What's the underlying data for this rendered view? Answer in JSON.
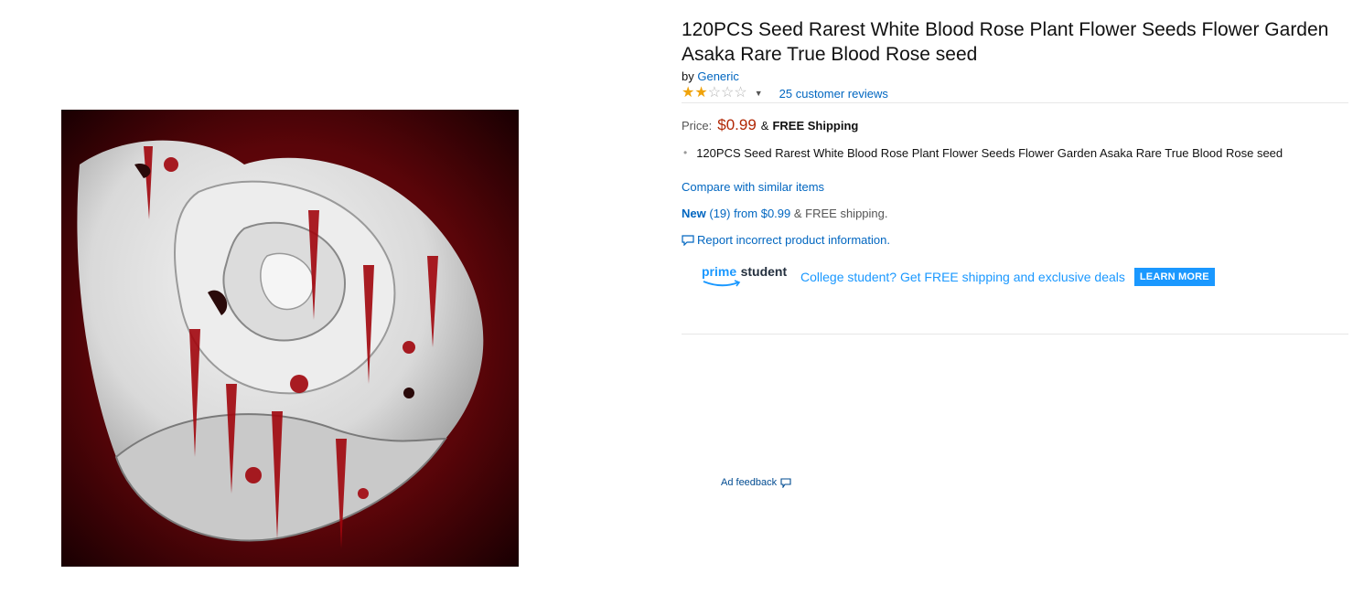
{
  "product": {
    "title": "120PCS Seed Rarest White Blood Rose Plant Flower Seeds Flower Garden Asaka Rare True Blood Rose seed",
    "by_prefix": "by",
    "brand": "Generic",
    "rating": {
      "stars": 2,
      "max": 5,
      "reviews_text": "25 customer reviews"
    },
    "price": {
      "label": "Price:",
      "value": "$0.99",
      "amp": "&",
      "shipping": "FREE Shipping"
    },
    "bullets": [
      "120PCS Seed Rarest White Blood Rose Plant Flower Seeds Flower Garden Asaka Rare True Blood Rose seed"
    ],
    "compare_link": "Compare with similar items",
    "offers": {
      "new_label": "New",
      "count": "(19)",
      "from_text": "from $0.99",
      "rest": "& FREE shipping."
    },
    "report_link": "Report incorrect product information."
  },
  "prime_student": {
    "prime": "prime",
    "student": "student",
    "promo_text": "College student? Get FREE shipping and exclusive deals",
    "button": "LEARN MORE"
  },
  "ad_feedback": "Ad feedback",
  "colors": {
    "price": "#b12704",
    "link": "#0066c0",
    "star": "#f0a30a",
    "prime_blue": "#1a98ff"
  },
  "icons": [
    "star-icon",
    "chevron-down-icon",
    "comment-icon",
    "amazon-smile-icon"
  ]
}
